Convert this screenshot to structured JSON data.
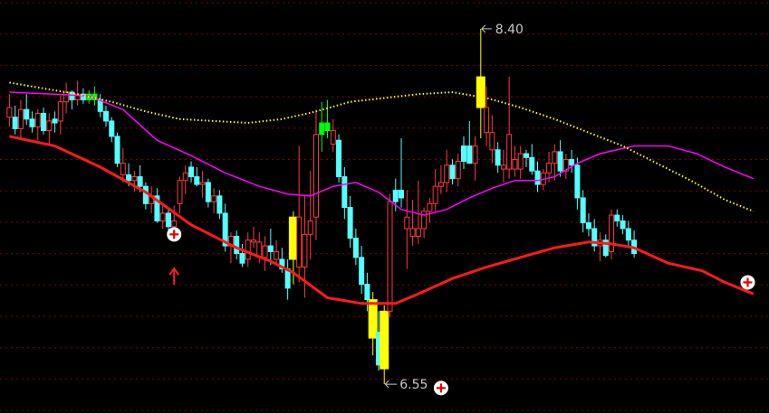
{
  "chart_data": {
    "type": "candlestick",
    "ylim": [
      6.4,
      8.55
    ],
    "grid": true,
    "colors": {
      "background": "#000000",
      "grid": "#8b0000",
      "up": "#ff3b3b",
      "down": "#54ffff",
      "highlight": "#ffff00",
      "signal": "#00ff00",
      "ma_short": "#ff00ff",
      "ma_mid": "#ffff00",
      "ma_long": "#ff1a1a",
      "label": "#c8c8c8"
    },
    "annotations": {
      "high_label": "8.40",
      "low_label": "6.55",
      "high_value": 8.4,
      "low_value": 6.55
    },
    "markers": [
      {
        "type": "plus-circle-icon",
        "index": 29,
        "price": 7.33
      },
      {
        "type": "plus-circle-icon",
        "index": 76,
        "price": 6.53
      },
      {
        "type": "plus-circle-icon",
        "index": 130,
        "price": 7.08
      }
    ],
    "arrows": [
      {
        "type": "up-arrow-icon",
        "index": 29,
        "price": 7.11
      }
    ],
    "candles": [
      {
        "o": 7.99,
        "h": 8.06,
        "l": 7.89,
        "c": 7.94,
        "color": "up"
      },
      {
        "o": 7.94,
        "h": 8.0,
        "l": 7.85,
        "c": 7.88,
        "color": "down"
      },
      {
        "o": 7.88,
        "h": 8.03,
        "l": 7.82,
        "c": 7.98,
        "color": "up"
      },
      {
        "o": 7.98,
        "h": 8.06,
        "l": 7.9,
        "c": 7.93,
        "color": "down"
      },
      {
        "o": 7.93,
        "h": 7.97,
        "l": 7.86,
        "c": 7.89,
        "color": "down"
      },
      {
        "o": 7.89,
        "h": 7.98,
        "l": 7.82,
        "c": 7.96,
        "color": "up"
      },
      {
        "o": 7.96,
        "h": 7.99,
        "l": 7.85,
        "c": 7.87,
        "color": "down"
      },
      {
        "o": 7.87,
        "h": 7.96,
        "l": 7.79,
        "c": 7.92,
        "color": "up"
      },
      {
        "o": 7.93,
        "h": 7.97,
        "l": 7.86,
        "c": 7.91,
        "color": "down"
      },
      {
        "o": 7.92,
        "h": 8.05,
        "l": 7.85,
        "c": 8.02,
        "color": "up"
      },
      {
        "o": 8.02,
        "h": 8.12,
        "l": 7.96,
        "c": 8.07,
        "color": "up"
      },
      {
        "o": 8.07,
        "h": 8.08,
        "l": 7.98,
        "c": 8.03,
        "color": "down"
      },
      {
        "o": 8.03,
        "h": 8.13,
        "l": 8.0,
        "c": 8.06,
        "color": "up"
      },
      {
        "o": 8.06,
        "h": 8.09,
        "l": 8.01,
        "c": 8.03,
        "color": "down"
      },
      {
        "o": 8.03,
        "h": 8.08,
        "l": 8.01,
        "c": 8.06,
        "color": "signal"
      },
      {
        "o": 8.06,
        "h": 8.1,
        "l": 8.0,
        "c": 8.03,
        "color": "signal"
      },
      {
        "o": 8.03,
        "h": 8.06,
        "l": 7.94,
        "c": 7.97,
        "color": "down"
      },
      {
        "o": 7.97,
        "h": 8.0,
        "l": 7.89,
        "c": 7.92,
        "color": "down"
      },
      {
        "o": 7.92,
        "h": 7.94,
        "l": 7.81,
        "c": 7.84,
        "color": "down"
      },
      {
        "o": 7.84,
        "h": 7.86,
        "l": 7.68,
        "c": 7.7,
        "color": "down"
      },
      {
        "o": 7.7,
        "h": 7.78,
        "l": 7.6,
        "c": 7.64,
        "color": "up"
      },
      {
        "o": 7.64,
        "h": 7.7,
        "l": 7.58,
        "c": 7.61,
        "color": "down"
      },
      {
        "o": 7.61,
        "h": 7.66,
        "l": 7.55,
        "c": 7.63,
        "color": "up"
      },
      {
        "o": 7.63,
        "h": 7.69,
        "l": 7.55,
        "c": 7.58,
        "color": "down"
      },
      {
        "o": 7.58,
        "h": 7.6,
        "l": 7.46,
        "c": 7.49,
        "color": "down"
      },
      {
        "o": 7.49,
        "h": 7.58,
        "l": 7.44,
        "c": 7.53,
        "color": "up"
      },
      {
        "o": 7.53,
        "h": 7.57,
        "l": 7.39,
        "c": 7.4,
        "color": "down"
      },
      {
        "o": 7.4,
        "h": 7.48,
        "l": 7.36,
        "c": 7.44,
        "color": "up"
      },
      {
        "o": 7.44,
        "h": 7.46,
        "l": 7.33,
        "c": 7.37,
        "color": "down"
      },
      {
        "o": 7.4,
        "h": 7.48,
        "l": 7.33,
        "c": 7.37,
        "color": "up"
      },
      {
        "o": 7.49,
        "h": 7.63,
        "l": 7.44,
        "c": 7.61,
        "color": "up"
      },
      {
        "o": 7.61,
        "h": 7.69,
        "l": 7.54,
        "c": 7.65,
        "color": "up"
      },
      {
        "o": 7.68,
        "h": 7.71,
        "l": 7.6,
        "c": 7.63,
        "color": "down"
      },
      {
        "o": 7.63,
        "h": 7.68,
        "l": 7.58,
        "c": 7.59,
        "color": "down"
      },
      {
        "o": 7.59,
        "h": 7.66,
        "l": 7.52,
        "c": 7.6,
        "color": "up"
      },
      {
        "o": 7.6,
        "h": 7.62,
        "l": 7.47,
        "c": 7.5,
        "color": "down"
      },
      {
        "o": 7.5,
        "h": 7.57,
        "l": 7.44,
        "c": 7.53,
        "color": "up"
      },
      {
        "o": 7.53,
        "h": 7.56,
        "l": 7.41,
        "c": 7.44,
        "color": "down"
      },
      {
        "o": 7.44,
        "h": 7.49,
        "l": 7.24,
        "c": 7.27,
        "color": "down"
      },
      {
        "o": 7.27,
        "h": 7.34,
        "l": 7.18,
        "c": 7.32,
        "color": "up"
      },
      {
        "o": 7.32,
        "h": 7.35,
        "l": 7.2,
        "c": 7.23,
        "color": "down"
      },
      {
        "o": 7.23,
        "h": 7.28,
        "l": 7.16,
        "c": 7.18,
        "color": "down"
      },
      {
        "o": 7.2,
        "h": 7.34,
        "l": 7.16,
        "c": 7.3,
        "color": "up"
      },
      {
        "o": 7.3,
        "h": 7.37,
        "l": 7.26,
        "c": 7.29,
        "color": "up"
      },
      {
        "o": 7.29,
        "h": 7.34,
        "l": 7.18,
        "c": 7.21,
        "color": "up"
      },
      {
        "o": 7.21,
        "h": 7.32,
        "l": 7.14,
        "c": 7.27,
        "color": "up"
      },
      {
        "o": 7.27,
        "h": 7.36,
        "l": 7.17,
        "c": 7.24,
        "color": "down"
      },
      {
        "o": 7.24,
        "h": 7.3,
        "l": 7.17,
        "c": 7.2,
        "color": "up"
      },
      {
        "o": 7.2,
        "h": 7.26,
        "l": 7.13,
        "c": 7.15,
        "color": "down"
      },
      {
        "o": 7.15,
        "h": 7.2,
        "l": 6.99,
        "c": 7.05,
        "color": "down"
      },
      {
        "o": 7.2,
        "h": 7.45,
        "l": 7.07,
        "c": 7.42,
        "color": "highlight"
      },
      {
        "o": 7.42,
        "h": 7.79,
        "l": 7.08,
        "c": 7.16,
        "color": "up"
      },
      {
        "o": 7.16,
        "h": 7.53,
        "l": 7.0,
        "c": 7.33,
        "color": "up"
      },
      {
        "o": 7.33,
        "h": 7.66,
        "l": 7.2,
        "c": 7.4,
        "color": "up"
      },
      {
        "o": 7.42,
        "h": 7.98,
        "l": 7.3,
        "c": 7.85,
        "color": "up"
      },
      {
        "o": 7.85,
        "h": 8.02,
        "l": 7.76,
        "c": 7.91,
        "color": "signal"
      },
      {
        "o": 7.91,
        "h": 8.03,
        "l": 7.83,
        "c": 7.87,
        "color": "signal"
      },
      {
        "o": 7.87,
        "h": 7.93,
        "l": 7.76,
        "c": 7.8,
        "color": "up"
      },
      {
        "o": 7.82,
        "h": 7.85,
        "l": 7.6,
        "c": 7.63,
        "color": "down"
      },
      {
        "o": 7.63,
        "h": 7.68,
        "l": 7.41,
        "c": 7.47,
        "color": "down"
      },
      {
        "o": 7.47,
        "h": 7.53,
        "l": 7.26,
        "c": 7.31,
        "color": "down"
      },
      {
        "o": 7.31,
        "h": 7.36,
        "l": 7.17,
        "c": 7.21,
        "color": "down"
      },
      {
        "o": 7.21,
        "h": 7.27,
        "l": 7.02,
        "c": 7.07,
        "color": "down"
      },
      {
        "o": 7.07,
        "h": 7.13,
        "l": 6.93,
        "c": 6.99,
        "color": "down"
      },
      {
        "o": 6.99,
        "h": 7.03,
        "l": 6.7,
        "c": 6.79,
        "color": "highlight"
      },
      {
        "o": 6.82,
        "h": 6.93,
        "l": 6.62,
        "c": 6.65,
        "color": "down"
      },
      {
        "o": 6.63,
        "h": 6.96,
        "l": 6.55,
        "c": 6.93,
        "color": "highlight"
      },
      {
        "o": 6.93,
        "h": 7.54,
        "l": 6.9,
        "c": 7.5,
        "color": "up"
      },
      {
        "o": 7.5,
        "h": 7.62,
        "l": 7.45,
        "c": 7.56,
        "color": "down"
      },
      {
        "o": 7.56,
        "h": 7.83,
        "l": 7.47,
        "c": 7.52,
        "color": "down"
      },
      {
        "o": 7.42,
        "h": 7.56,
        "l": 7.15,
        "c": 7.36,
        "color": "up"
      },
      {
        "o": 7.36,
        "h": 7.51,
        "l": 7.27,
        "c": 7.32,
        "color": "up"
      },
      {
        "o": 7.32,
        "h": 7.61,
        "l": 7.28,
        "c": 7.36,
        "color": "up"
      },
      {
        "o": 7.36,
        "h": 7.47,
        "l": 7.31,
        "c": 7.45,
        "color": "up"
      },
      {
        "o": 7.45,
        "h": 7.52,
        "l": 7.39,
        "c": 7.49,
        "color": "up"
      },
      {
        "o": 7.49,
        "h": 7.67,
        "l": 7.45,
        "c": 7.58,
        "color": "up"
      },
      {
        "o": 7.58,
        "h": 7.69,
        "l": 7.54,
        "c": 7.6,
        "color": "up"
      },
      {
        "o": 7.6,
        "h": 7.77,
        "l": 7.55,
        "c": 7.69,
        "color": "up"
      },
      {
        "o": 7.69,
        "h": 7.72,
        "l": 7.59,
        "c": 7.62,
        "color": "down"
      },
      {
        "o": 7.62,
        "h": 7.75,
        "l": 7.58,
        "c": 7.71,
        "color": "up"
      },
      {
        "o": 7.71,
        "h": 7.84,
        "l": 7.67,
        "c": 7.79,
        "color": "down"
      },
      {
        "o": 7.79,
        "h": 7.92,
        "l": 7.7,
        "c": 7.7,
        "color": "down"
      },
      {
        "o": 7.7,
        "h": 7.84,
        "l": 7.61,
        "c": 7.79,
        "color": "up"
      },
      {
        "o": 8.15,
        "h": 8.4,
        "l": 7.83,
        "c": 7.99,
        "color": "highlight"
      },
      {
        "o": 7.99,
        "h": 8.1,
        "l": 7.79,
        "c": 7.86,
        "color": "up"
      },
      {
        "o": 7.86,
        "h": 7.95,
        "l": 7.7,
        "c": 7.77,
        "color": "up"
      },
      {
        "o": 7.77,
        "h": 7.81,
        "l": 7.65,
        "c": 7.69,
        "color": "down"
      },
      {
        "o": 7.69,
        "h": 7.77,
        "l": 7.6,
        "c": 7.67,
        "color": "up"
      },
      {
        "o": 7.67,
        "h": 8.15,
        "l": 7.62,
        "c": 7.85,
        "color": "up"
      },
      {
        "o": 7.72,
        "h": 7.79,
        "l": 7.63,
        "c": 7.67,
        "color": "up"
      },
      {
        "o": 7.67,
        "h": 7.79,
        "l": 7.62,
        "c": 7.75,
        "color": "up"
      },
      {
        "o": 7.75,
        "h": 7.77,
        "l": 7.68,
        "c": 7.73,
        "color": "down"
      },
      {
        "o": 7.73,
        "h": 7.8,
        "l": 7.64,
        "c": 7.66,
        "color": "down"
      },
      {
        "o": 7.66,
        "h": 7.71,
        "l": 7.55,
        "c": 7.59,
        "color": "down"
      },
      {
        "o": 7.59,
        "h": 7.67,
        "l": 7.56,
        "c": 7.65,
        "color": "up"
      },
      {
        "o": 7.65,
        "h": 7.76,
        "l": 7.6,
        "c": 7.7,
        "color": "up"
      },
      {
        "o": 7.7,
        "h": 7.8,
        "l": 7.61,
        "c": 7.76,
        "color": "up"
      },
      {
        "o": 7.76,
        "h": 7.82,
        "l": 7.63,
        "c": 7.66,
        "color": "down"
      },
      {
        "o": 7.66,
        "h": 7.75,
        "l": 7.62,
        "c": 7.72,
        "color": "up"
      },
      {
        "o": 7.72,
        "h": 7.77,
        "l": 7.65,
        "c": 7.69,
        "color": "down"
      },
      {
        "o": 7.69,
        "h": 7.73,
        "l": 7.46,
        "c": 7.52,
        "color": "down"
      },
      {
        "o": 7.52,
        "h": 7.56,
        "l": 7.34,
        "c": 7.39,
        "color": "down"
      },
      {
        "o": 7.39,
        "h": 7.44,
        "l": 7.32,
        "c": 7.36,
        "color": "down"
      },
      {
        "o": 7.36,
        "h": 7.41,
        "l": 7.24,
        "c": 7.27,
        "color": "down"
      },
      {
        "o": 7.27,
        "h": 7.34,
        "l": 7.19,
        "c": 7.3,
        "color": "up"
      },
      {
        "o": 7.3,
        "h": 7.33,
        "l": 7.21,
        "c": 7.22,
        "color": "down"
      },
      {
        "o": 7.24,
        "h": 7.46,
        "l": 7.2,
        "c": 7.43,
        "color": "up"
      },
      {
        "o": 7.43,
        "h": 7.46,
        "l": 7.37,
        "c": 7.4,
        "color": "down"
      },
      {
        "o": 7.4,
        "h": 7.43,
        "l": 7.33,
        "c": 7.36,
        "color": "down"
      },
      {
        "o": 7.36,
        "h": 7.4,
        "l": 7.26,
        "c": 7.3,
        "color": "down"
      },
      {
        "o": 7.3,
        "h": 7.35,
        "l": 7.21,
        "c": 7.23,
        "color": "down"
      }
    ],
    "ma_short": [
      [
        0,
        8.07
      ],
      [
        8,
        8.06
      ],
      [
        14,
        8.05
      ],
      [
        20,
        7.98
      ],
      [
        26,
        7.82
      ],
      [
        32,
        7.74
      ],
      [
        38,
        7.65
      ],
      [
        44,
        7.58
      ],
      [
        49,
        7.54
      ],
      [
        53,
        7.53
      ],
      [
        57,
        7.58
      ],
      [
        61,
        7.6
      ],
      [
        65,
        7.55
      ],
      [
        69,
        7.46
      ],
      [
        73,
        7.43
      ],
      [
        77,
        7.46
      ],
      [
        81,
        7.52
      ],
      [
        85,
        7.57
      ],
      [
        89,
        7.61
      ],
      [
        93,
        7.61
      ],
      [
        96,
        7.63
      ],
      [
        100,
        7.7
      ],
      [
        104,
        7.75
      ],
      [
        110,
        7.79
      ],
      [
        116,
        7.79
      ],
      [
        121,
        7.75
      ],
      [
        126,
        7.68
      ],
      [
        131,
        7.62
      ]
    ],
    "ma_mid": [
      [
        0,
        8.12
      ],
      [
        6,
        8.09
      ],
      [
        12,
        8.06
      ],
      [
        18,
        8.02
      ],
      [
        24,
        7.97
      ],
      [
        30,
        7.93
      ],
      [
        36,
        7.92
      ],
      [
        42,
        7.91
      ],
      [
        48,
        7.93
      ],
      [
        54,
        7.97
      ],
      [
        60,
        8.02
      ],
      [
        66,
        8.04
      ],
      [
        72,
        8.06
      ],
      [
        78,
        8.07
      ],
      [
        84,
        8.04
      ],
      [
        90,
        7.99
      ],
      [
        96,
        7.93
      ],
      [
        102,
        7.86
      ],
      [
        108,
        7.79
      ],
      [
        114,
        7.7
      ],
      [
        120,
        7.61
      ],
      [
        126,
        7.51
      ],
      [
        131,
        7.45
      ]
    ],
    "ma_long": [
      [
        0,
        7.84
      ],
      [
        8,
        7.79
      ],
      [
        16,
        7.68
      ],
      [
        24,
        7.55
      ],
      [
        32,
        7.38
      ],
      [
        40,
        7.26
      ],
      [
        46,
        7.19
      ],
      [
        50,
        7.13
      ],
      [
        56,
        7.0
      ],
      [
        62,
        6.97
      ],
      [
        68,
        6.97
      ],
      [
        72,
        7.02
      ],
      [
        78,
        7.1
      ],
      [
        84,
        7.16
      ],
      [
        90,
        7.21
      ],
      [
        96,
        7.26
      ],
      [
        102,
        7.29
      ],
      [
        106,
        7.28
      ],
      [
        110,
        7.26
      ],
      [
        116,
        7.18
      ],
      [
        122,
        7.14
      ],
      [
        126,
        7.08
      ],
      [
        131,
        7.02
      ]
    ]
  }
}
